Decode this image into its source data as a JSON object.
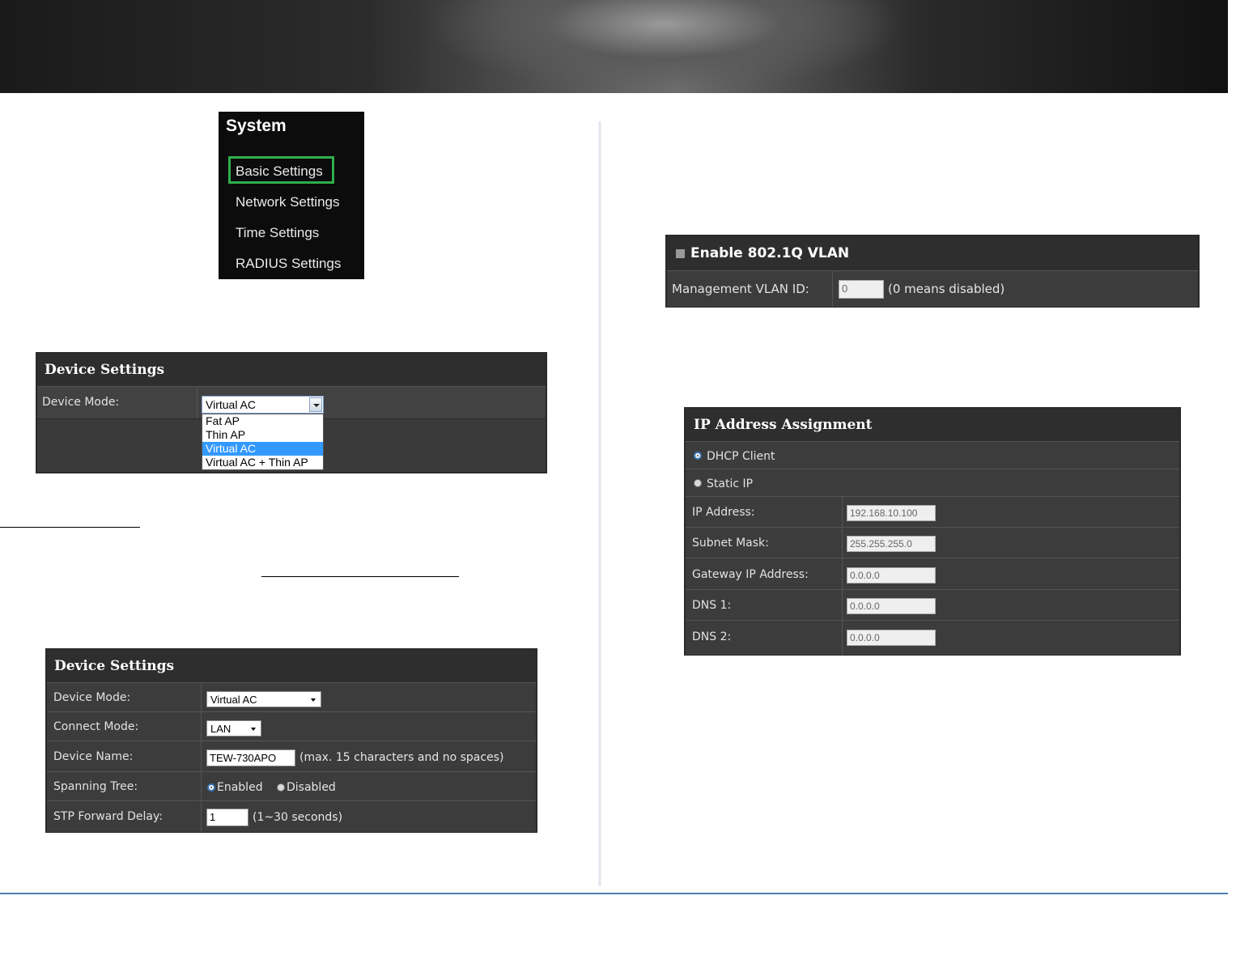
{
  "system_menu": {
    "title": "System",
    "items": [
      {
        "label": "Basic Settings"
      },
      {
        "label": "Network Settings"
      },
      {
        "label": "Time Settings"
      },
      {
        "label": "RADIUS Settings"
      }
    ]
  },
  "device_settings_dropdown": {
    "title": "Device Settings",
    "device_mode_label": "Device Mode:",
    "selected": "Virtual AC",
    "options": [
      "Fat AP",
      "Thin AP",
      "Virtual AC",
      "Virtual AC + Thin AP"
    ]
  },
  "device_settings": {
    "title": "Device Settings",
    "device_mode_label": "Device Mode:",
    "device_mode_value": "Virtual AC",
    "connect_mode_label": "Connect Mode:",
    "connect_mode_value": "LAN",
    "device_name_label": "Device Name:",
    "device_name_value": "TEW-730APO",
    "device_name_hint": "(max. 15 characters and no spaces)",
    "spanning_tree_label": "Spanning Tree:",
    "enabled_label": "Enabled",
    "disabled_label": "Disabled",
    "stp_label": "STP Forward Delay:",
    "stp_value": "1",
    "stp_hint": "(1~30 seconds)"
  },
  "vlan": {
    "title": "Enable 802.1Q VLAN",
    "mgmt_label": "Management VLAN ID:",
    "mgmt_value": "0",
    "mgmt_hint": "(0 means disabled)"
  },
  "ip_assignment": {
    "title": "IP Address Assignment",
    "dhcp_label": "DHCP Client",
    "static_label": "Static IP",
    "ip_label": "IP Address:",
    "ip_value": "192.168.10.100",
    "mask_label": "Subnet Mask:",
    "mask_value": "255.255.255.0",
    "gw_label": "Gateway IP Address:",
    "gw_value": "0.0.0.0",
    "dns1_label": "DNS 1:",
    "dns1_value": "0.0.0.0",
    "dns2_label": "DNS 2:",
    "dns2_value": "0.0.0.0"
  },
  "colors": {
    "accent_green": "#2fae4c",
    "select_blue": "#3399ff",
    "panel_bg": "#3a3a3a",
    "footer_line": "#4f7fae"
  }
}
